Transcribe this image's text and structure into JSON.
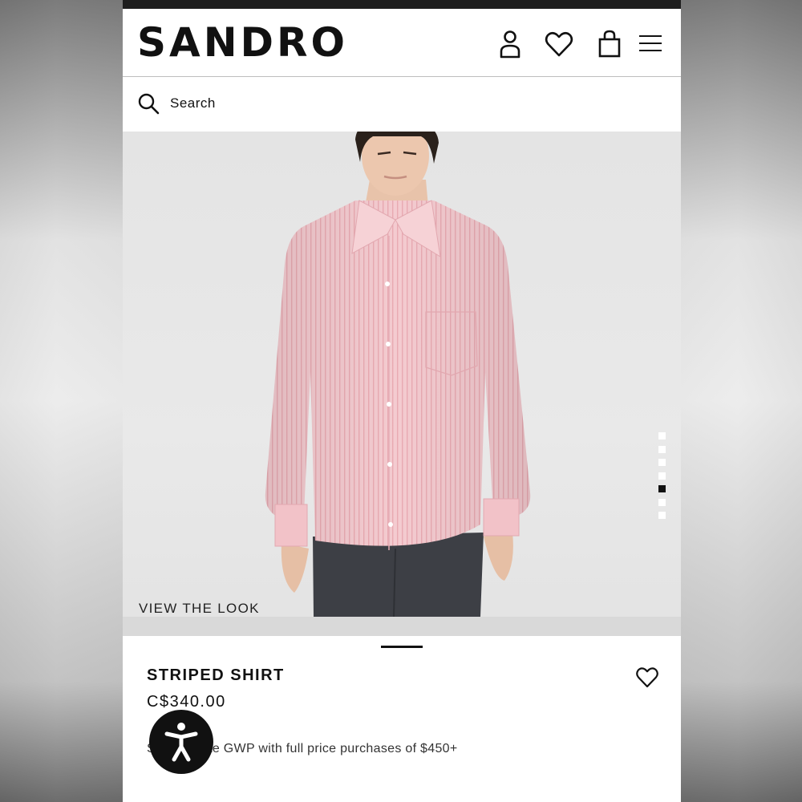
{
  "brand": {
    "logo_text": "SANDRO"
  },
  "header_icons": [
    "account-icon",
    "wishlist-icon",
    "bag-icon",
    "menu-icon"
  ],
  "search": {
    "label": "Search"
  },
  "gallery": {
    "image_count": 7,
    "active_index": 5,
    "view_the_look": "VIEW THE LOOK"
  },
  "product": {
    "name": "STRIPED SHIRT",
    "price": "C$340.00",
    "promo": "S            ote GWP with full price purchases of $450+"
  },
  "colors": {
    "shirt": "#f2c6cb",
    "accent": "#111111"
  }
}
